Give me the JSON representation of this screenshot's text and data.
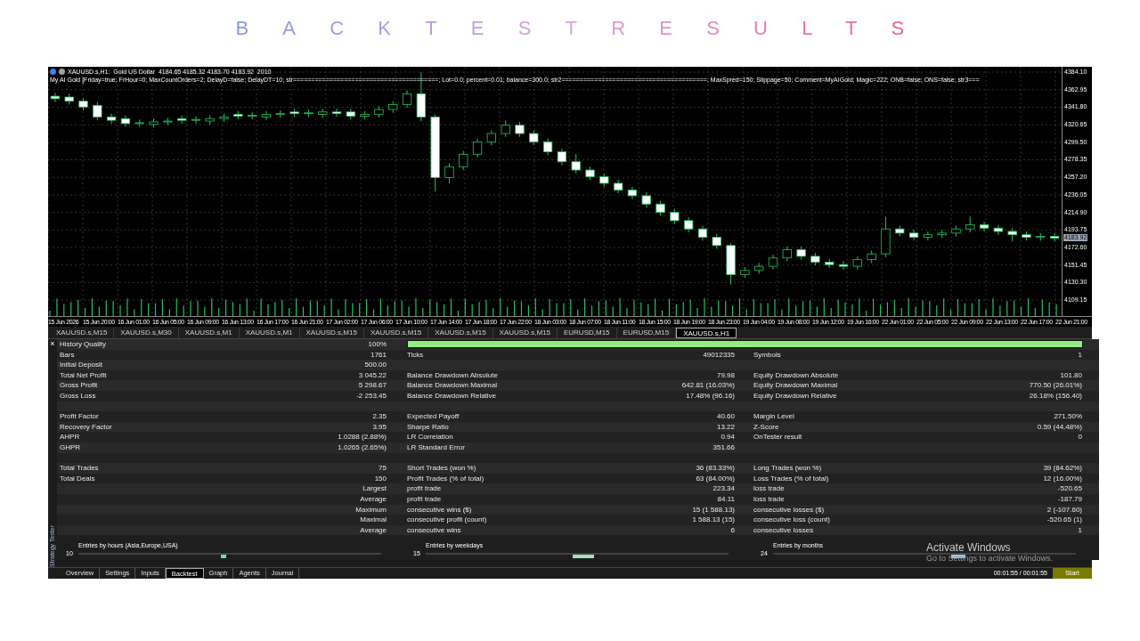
{
  "page_title": "BACKTESTRESULTS",
  "chart": {
    "header": "XAUUSD.s,H1:  Gold US Dollar  4184.65 4185.32 4183.70 4183.92  2010",
    "expert_line": "My AI Gold [Friday=true; FrHour=0; MaxCountOrders=2; DelayD=false; DelayDT=10; str========================================; Lot=0.0; percent=0.01; balance=300.0; str2========================================; MaxSpred=150; Slippage=50; Comment=MyAIGold; Magic=222; ONB=false; ONS=false; str3===",
    "current_price": "4183.92",
    "time_labels": [
      "15 Jun 2026",
      "15 Jun 20:00",
      "16 Jun 01:00",
      "16 Jun 05:00",
      "16 Jun 09:00",
      "16 Jun 13:00",
      "16 Jun 17:00",
      "16 Jun 21:00",
      "17 Jun 02:00",
      "17 Jun 06:00",
      "17 Jun 10:00",
      "17 Jun 14:00",
      "17 Jun 18:00",
      "17 Jun 22:00",
      "18 Jun 03:00",
      "18 Jun 07:00",
      "18 Jun 11:00",
      "18 Jun 15:00",
      "18 Jun 19:00",
      "18 Jun 23:00",
      "19 Jun 04:00",
      "19 Jun 08:00",
      "19 Jun 12:00",
      "19 Jun 16:00",
      "22 Jun 01:00",
      "22 Jun 05:00",
      "22 Jun 09:00",
      "22 Jun 13:00",
      "22 Jun 17:00",
      "22 Jun 21:00"
    ],
    "chart_data": {
      "type": "candlestick",
      "grid": true,
      "ylim": [
        4090,
        4390.5
      ],
      "yticks": [
        {
          "value": 4384.1,
          "label": "4384.10"
        },
        {
          "value": 4362.95,
          "label": "4362.95"
        },
        {
          "value": 4341.8,
          "label": "4341.80"
        },
        {
          "value": 4320.65,
          "label": "4320.65"
        },
        {
          "value": 4299.5,
          "label": "4299.50"
        },
        {
          "value": 4278.35,
          "label": "4278.35"
        },
        {
          "value": 4257.2,
          "label": "4257.20"
        },
        {
          "value": 4236.05,
          "label": "4236.05"
        },
        {
          "value": 4214.9,
          "label": "4214.90"
        },
        {
          "value": 4193.75,
          "label": "4193.75"
        },
        {
          "value": 4172.6,
          "label": "4172.60"
        },
        {
          "value": 4151.45,
          "label": "4151.45"
        },
        {
          "value": 4130.3,
          "label": "4130.30"
        },
        {
          "value": 4109.15,
          "label": "4109.15"
        }
      ],
      "categories": [
        null,
        null,
        null,
        null,
        null,
        null,
        null,
        null,
        null,
        null,
        null,
        null,
        null,
        null,
        null,
        null,
        null,
        null,
        null,
        null,
        null,
        null,
        null,
        null,
        null,
        null,
        null,
        null,
        null,
        null,
        null,
        null,
        null,
        null,
        null,
        null,
        null,
        null,
        null,
        null,
        null,
        null,
        null,
        null,
        null,
        null,
        null,
        null,
        null,
        null,
        null,
        null,
        null,
        null,
        null,
        null,
        null,
        null,
        null,
        null,
        null,
        null,
        null,
        null,
        null,
        null,
        null,
        null,
        null,
        null,
        null,
        null
      ],
      "ohlc": [
        [
          4355,
          4359,
          4348,
          4352
        ],
        [
          4354,
          4358,
          4345,
          4349
        ],
        [
          4349,
          4353,
          4338,
          4342
        ],
        [
          4344,
          4348,
          4326,
          4330
        ],
        [
          4330,
          4334,
          4322,
          4326
        ],
        [
          4328,
          4332,
          4318,
          4322
        ],
        [
          4322,
          4327,
          4318,
          4323
        ],
        [
          4321,
          4328,
          4317,
          4324
        ],
        [
          4324,
          4329,
          4320,
          4325
        ],
        [
          4328,
          4332,
          4322,
          4326
        ],
        [
          4326,
          4331,
          4322,
          4327
        ],
        [
          4325,
          4332,
          4321,
          4328
        ],
        [
          4328,
          4334,
          4324,
          4330
        ],
        [
          4333,
          4337,
          4327,
          4331
        ],
        [
          4331,
          4336,
          4327,
          4332
        ],
        [
          4330,
          4337,
          4326,
          4333
        ],
        [
          4333,
          4338,
          4329,
          4334
        ],
        [
          4336,
          4340,
          4330,
          4334
        ],
        [
          4334,
          4339,
          4330,
          4335
        ],
        [
          4333,
          4340,
          4329,
          4336
        ],
        [
          4336,
          4340,
          4330,
          4334
        ],
        [
          4336,
          4340,
          4327,
          4331
        ],
        [
          4331,
          4337,
          4327,
          4333
        ],
        [
          4333,
          4343,
          4329,
          4339
        ],
        [
          4339,
          4349,
          4335,
          4345
        ],
        [
          4345,
          4362,
          4341,
          4358
        ],
        [
          4358,
          4384,
          4325,
          4330
        ],
        [
          4330,
          4333,
          4240,
          4257
        ],
        [
          4257,
          4274,
          4250,
          4270
        ],
        [
          4270,
          4289,
          4266,
          4285
        ],
        [
          4285,
          4304,
          4281,
          4300
        ],
        [
          4300,
          4314,
          4296,
          4310
        ],
        [
          4310,
          4326,
          4306,
          4320
        ],
        [
          4320,
          4324,
          4306,
          4310
        ],
        [
          4310,
          4314,
          4296,
          4300
        ],
        [
          4300,
          4304,
          4284,
          4288
        ],
        [
          4288,
          4292,
          4272,
          4276
        ],
        [
          4276,
          4285,
          4262,
          4266
        ],
        [
          4266,
          4270,
          4254,
          4258
        ],
        [
          4258,
          4262,
          4246,
          4250
        ],
        [
          4250,
          4254,
          4238,
          4242
        ],
        [
          4242,
          4246,
          4231,
          4235
        ],
        [
          4235,
          4239,
          4221,
          4225
        ],
        [
          4225,
          4229,
          4211,
          4215
        ],
        [
          4215,
          4219,
          4201,
          4205
        ],
        [
          4205,
          4209,
          4191,
          4195
        ],
        [
          4195,
          4199,
          4181,
          4185
        ],
        [
          4185,
          4189,
          4171,
          4175
        ],
        [
          4175,
          4178,
          4128,
          4140
        ],
        [
          4140,
          4149,
          4136,
          4145
        ],
        [
          4145,
          4154,
          4141,
          4150
        ],
        [
          4150,
          4164,
          4146,
          4160
        ],
        [
          4160,
          4174,
          4156,
          4170
        ],
        [
          4170,
          4174,
          4158,
          4162
        ],
        [
          4162,
          4166,
          4151,
          4155
        ],
        [
          4155,
          4159,
          4148,
          4152
        ],
        [
          4152,
          4156,
          4146,
          4150
        ],
        [
          4150,
          4162,
          4146,
          4158
        ],
        [
          4158,
          4169,
          4154,
          4165
        ],
        [
          4165,
          4210,
          4161,
          4195
        ],
        [
          4195,
          4199,
          4186,
          4190
        ],
        [
          4190,
          4194,
          4181,
          4185
        ],
        [
          4185,
          4192,
          4181,
          4188
        ],
        [
          4188,
          4194,
          4184,
          4190
        ],
        [
          4190,
          4199,
          4186,
          4195
        ],
        [
          4195,
          4210,
          4191,
          4200
        ],
        [
          4200,
          4204,
          4192,
          4196
        ],
        [
          4196,
          4200,
          4188,
          4192
        ],
        [
          4192,
          4196,
          4180,
          4188
        ],
        [
          4188,
          4192,
          4181,
          4185
        ],
        [
          4185,
          4190,
          4181,
          4186
        ],
        [
          4186,
          4190,
          4180,
          4184
        ]
      ]
    }
  },
  "chart_tabs": [
    {
      "label": "XAUUSD.s,M15",
      "selected": false
    },
    {
      "label": "XAUUSD.s,M30",
      "selected": false
    },
    {
      "label": "XAUUSD.s,M1",
      "selected": false
    },
    {
      "label": "XAUUSD.s,M1",
      "selected": false
    },
    {
      "label": "XAUUSD.s,M15",
      "selected": false
    },
    {
      "label": "XAUUSD.s,M15",
      "selected": false
    },
    {
      "label": "XAUUSD.s,M15",
      "selected": false
    },
    {
      "label": "XAUUSD.s,M15",
      "selected": false
    },
    {
      "label": "EURUSD,M15",
      "selected": false
    },
    {
      "label": "EURUSD,M15",
      "selected": false
    },
    {
      "label": "XAUUSD.s,H1",
      "selected": true
    }
  ],
  "close_icon": "×",
  "results": [
    {
      "kind": "quality",
      "cells": [
        "History Quality",
        "100%"
      ],
      "level": 1
    },
    {
      "kind": "stat",
      "cells": [
        "Bars",
        "1761",
        "Ticks",
        "49012335",
        "Symbols",
        "1"
      ]
    },
    {
      "kind": "stat",
      "cells": [
        "Initial Deposit",
        "500.00"
      ]
    },
    {
      "kind": "stat",
      "cells": [
        "Total Net Profit",
        "3 045.22",
        "Balance Drawdown Absolute",
        "79.98",
        "Equity Drawdown Absolute",
        "101.80"
      ]
    },
    {
      "kind": "stat",
      "cells": [
        "Gross Profit",
        "5 298.67",
        "Balance Drawdown Maximal",
        "642.81 (16.03%)",
        "Equity Drawdown Maximal",
        "770.50 (26.01%)"
      ]
    },
    {
      "kind": "stat",
      "cells": [
        "Gross Loss",
        "-2 253.45",
        "Balance Drawdown Relative",
        "17.48% (96.16)",
        "Equity Drawdown Relative",
        "26.18% (156.40)"
      ]
    },
    {
      "kind": "spacer"
    },
    {
      "kind": "stat",
      "cells": [
        "Profit Factor",
        "2.35",
        "Expected Payoff",
        "40.60",
        "Margin Level",
        "271.50%"
      ]
    },
    {
      "kind": "stat",
      "cells": [
        "Recovery Factor",
        "3.95",
        "Sharpe Ratio",
        "13.22",
        "Z-Score",
        "0.59 (44.48%)"
      ]
    },
    {
      "kind": "stat",
      "cells": [
        "AHPR",
        "1.0288 (2.88%)",
        "LR Correlation",
        "0.94",
        "OnTester result",
        "0"
      ]
    },
    {
      "kind": "stat",
      "cells": [
        "GHPR",
        "1.0265 (2.65%)",
        "LR Standard Error",
        "351.66"
      ]
    },
    {
      "kind": "spacer"
    },
    {
      "kind": "stat",
      "cells": [
        "Total Trades",
        "75",
        "Short Trades (won %)",
        "36 (83.33%)",
        "Long Trades (won %)",
        "39 (84.62%)"
      ]
    },
    {
      "kind": "stat",
      "cells": [
        "Total Deals",
        "150",
        "Profit Trades (% of total)",
        "63 (84.00%)",
        "Loss Trades (% of total)",
        "12 (16.00%)"
      ]
    },
    {
      "kind": "sub",
      "cells": [
        "Largest",
        "profit trade",
        "223.34",
        "loss trade",
        "-520.65"
      ]
    },
    {
      "kind": "sub",
      "cells": [
        "Average",
        "profit trade",
        "84.11",
        "loss trade",
        "-187.79"
      ]
    },
    {
      "kind": "sub",
      "cells": [
        "Maximum",
        "consecutive wins ($)",
        "15 (1 588.13)",
        "consecutive losses ($)",
        "2 (-107.60)"
      ]
    },
    {
      "kind": "sub",
      "cells": [
        "Maximal",
        "consecutive profit (count)",
        "1 588.13 (15)",
        "consecutive loss (count)",
        "-520.65 (1)"
      ]
    },
    {
      "kind": "sub",
      "cells": [
        "Average",
        "consecutive wins",
        "6",
        "consecutive losses",
        "1"
      ]
    }
  ],
  "entries": [
    {
      "title": "Entries by hours (Asia,Europe,USA)",
      "tick": "10"
    },
    {
      "title": "Entries by weekdays",
      "tick": "15"
    },
    {
      "title": "Entries by months",
      "tick": "24"
    }
  ],
  "side_label": "Strategy Tester",
  "bottom_tabs": [
    {
      "label": "Overview",
      "selected": false
    },
    {
      "label": "Settings",
      "selected": false
    },
    {
      "label": "Inputs",
      "selected": false
    },
    {
      "label": "Backtest",
      "selected": true
    },
    {
      "label": "Graph",
      "selected": false
    },
    {
      "label": "Agents",
      "selected": false
    },
    {
      "label": "Journal",
      "selected": false
    }
  ],
  "elapsed": "00:01:55 / 00:01:55",
  "start_button": "Start",
  "os_notice": {
    "title": "Activate Windows",
    "text": "Go to Settings to activate Windows."
  }
}
